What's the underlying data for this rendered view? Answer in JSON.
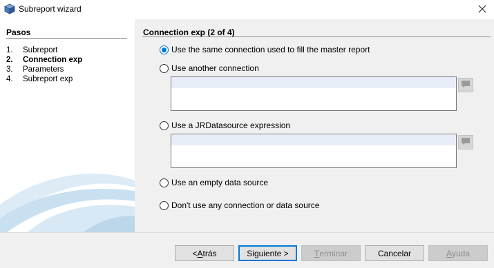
{
  "window": {
    "title": "Subreport wizard"
  },
  "steps": {
    "title": "Pasos",
    "items": [
      {
        "num": "1.",
        "label": "Subreport",
        "active": false
      },
      {
        "num": "2.",
        "label": "Connection exp",
        "active": true
      },
      {
        "num": "3.",
        "label": "Parameters",
        "active": false
      },
      {
        "num": "4.",
        "label": "Subreport exp",
        "active": false
      }
    ]
  },
  "main": {
    "section_title": "Connection exp (2 of 4)",
    "options": {
      "same_connection": "Use the same connection used to fill the master report",
      "another_connection": "Use another connection",
      "jr_datasource": "Use a JRDatasource expression",
      "empty_datasource": "Use an empty data source",
      "no_connection": "Don't use any connection or data source"
    },
    "selected_option": "same_connection",
    "connection_expression_value": "",
    "datasource_expression_value": ""
  },
  "buttons": {
    "back": {
      "pre": "< ",
      "mnemonic": "A",
      "post": "trás",
      "enabled": true
    },
    "next": {
      "label": "Siguiente >",
      "enabled": true
    },
    "finish": {
      "pre": "",
      "mnemonic": "T",
      "post": "erminar",
      "enabled": false
    },
    "cancel": {
      "label": "Cancelar",
      "enabled": true
    },
    "help": {
      "pre": "",
      "mnemonic": "A",
      "post": "yuda",
      "enabled": false
    }
  },
  "colors": {
    "accent": "#0078d7",
    "panel_bg": "#f0f0f0",
    "swoosh": "#bcd6ea"
  }
}
